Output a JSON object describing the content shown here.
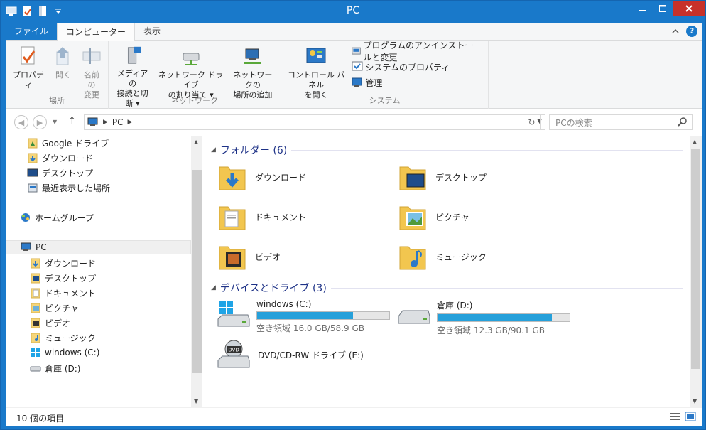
{
  "window": {
    "title": "PC"
  },
  "ribbon_tabs": [
    {
      "label": "ファイル"
    },
    {
      "label": "コンピューター"
    },
    {
      "label": "表示"
    }
  ],
  "ribbon": {
    "location": {
      "label": "場所",
      "properties": "プロパティ",
      "open": "開く",
      "rename_l1": "名前の",
      "rename_l2": "変更"
    },
    "network": {
      "label": "ネットワーク",
      "media_l1": "メディアの",
      "media_l2": "接続と切断",
      "mapdrive_l1": "ネットワーク ドライブ",
      "mapdrive_l2": "の割り当て",
      "addloc_l1": "ネットワークの",
      "addloc_l2": "場所の追加"
    },
    "system": {
      "label": "システム",
      "cpanel_l1": "コントロール パネル",
      "cpanel_l2": "を開く",
      "uninstall": "プログラムのアンインストールと変更",
      "sysprops": "システムのプロパティ",
      "manage": "管理"
    }
  },
  "address": {
    "crumbs": [
      "PC"
    ],
    "search_placeholder": "PCの検索"
  },
  "nav": {
    "favorites": [
      {
        "label": "Google ドライブ"
      },
      {
        "label": "ダウンロード"
      },
      {
        "label": "デスクトップ"
      },
      {
        "label": "最近表示した場所"
      }
    ],
    "homegroup": "ホームグループ",
    "pc": "PC",
    "pc_children": [
      {
        "label": "ダウンロード"
      },
      {
        "label": "デスクトップ"
      },
      {
        "label": "ドキュメント"
      },
      {
        "label": "ピクチャ"
      },
      {
        "label": "ビデオ"
      },
      {
        "label": "ミュージック"
      },
      {
        "label": "windows (C:)"
      },
      {
        "label": "倉庫 (D:)"
      }
    ]
  },
  "main": {
    "folders_header": "フォルダー (6)",
    "folders": [
      {
        "label": "ダウンロード"
      },
      {
        "label": "デスクトップ"
      },
      {
        "label": "ドキュメント"
      },
      {
        "label": "ピクチャ"
      },
      {
        "label": "ビデオ"
      },
      {
        "label": "ミュージック"
      }
    ],
    "devices_header": "デバイスとドライブ (3)",
    "drives": [
      {
        "label": "windows (C:)",
        "free": "空き領域 16.0 GB/58.9 GB",
        "used_fraction": 0.728
      },
      {
        "label": "倉庫 (D:)",
        "free": "空き領域 12.3 GB/90.1 GB",
        "used_fraction": 0.864
      }
    ],
    "dvd": "DVD/CD-RW ドライブ (E:)"
  },
  "status": {
    "count": "10 個の項目"
  },
  "colors": {
    "accent": "#1979ca",
    "close": "#c7312a",
    "bar": "#26a0da",
    "header": "#1e3287"
  }
}
